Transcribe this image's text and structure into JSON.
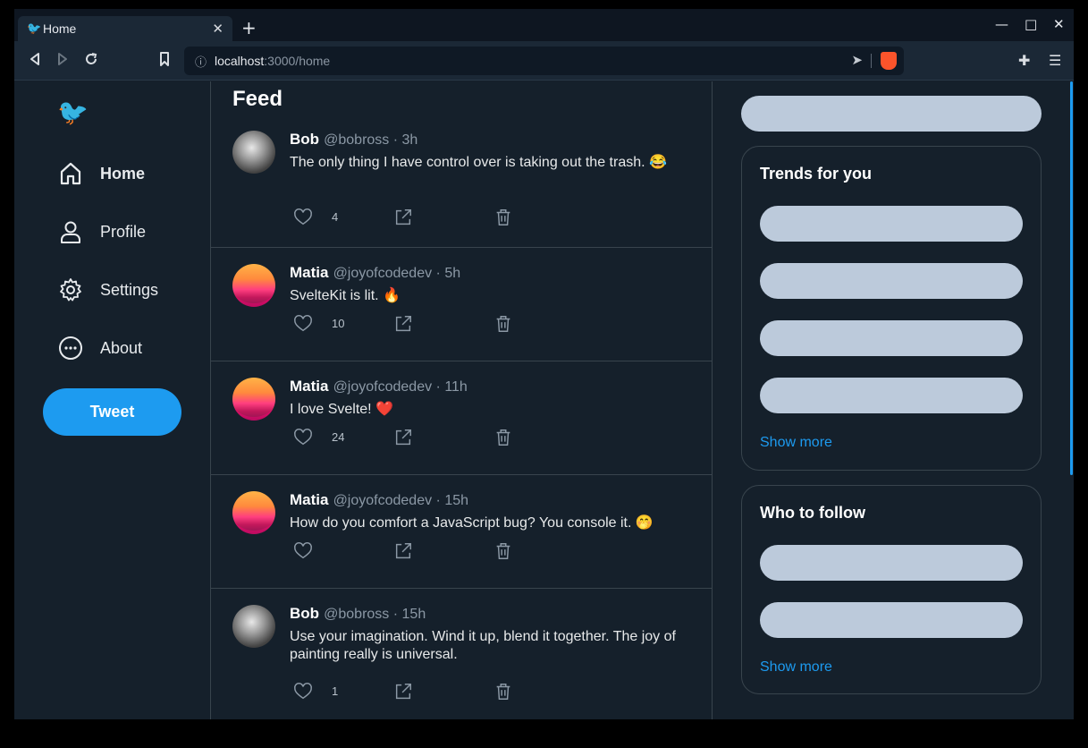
{
  "browser": {
    "tab_title": "Home",
    "new_tab": "+",
    "url_host": "localhost",
    "url_path": ":3000/home"
  },
  "sidebar": {
    "items": [
      {
        "label": "Home",
        "icon": "home-icon"
      },
      {
        "label": "Profile",
        "icon": "profile-icon"
      },
      {
        "label": "Settings",
        "icon": "gear-icon"
      },
      {
        "label": "About",
        "icon": "more-icon"
      }
    ],
    "tweet_button": "Tweet"
  },
  "feed": {
    "title": "Feed",
    "tweets": [
      {
        "name": "Bob",
        "handle": "@bobross · 3h",
        "text": "The only thing I have control over is taking out the trash. 😂",
        "likes": "4",
        "avatar": "bob"
      },
      {
        "name": "Matia",
        "handle": "@joyofcodedev · 5h",
        "text": "SvelteKit is lit. 🔥",
        "likes": "10",
        "avatar": "matia"
      },
      {
        "name": "Matia",
        "handle": "@joyofcodedev · 11h",
        "text": "I love Svelte! ❤️",
        "likes": "24",
        "avatar": "matia"
      },
      {
        "name": "Matia",
        "handle": "@joyofcodedev · 15h",
        "text": "How do you comfort a JavaScript bug? You console it. 🤭",
        "likes": "",
        "avatar": "matia"
      },
      {
        "name": "Bob",
        "handle": "@bobross · 15h",
        "text": "Use your imagination. Wind it up, blend it together. The joy of painting really is universal.",
        "likes": "1",
        "avatar": "bob"
      }
    ]
  },
  "right": {
    "trends_title": "Trends for you",
    "trends_show_more": "Show more",
    "follow_title": "Who to follow",
    "follow_show_more": "Show more"
  },
  "colors": {
    "background": "#15202b",
    "accent": "#1d9bf0",
    "placeholder": "#bccadb"
  }
}
